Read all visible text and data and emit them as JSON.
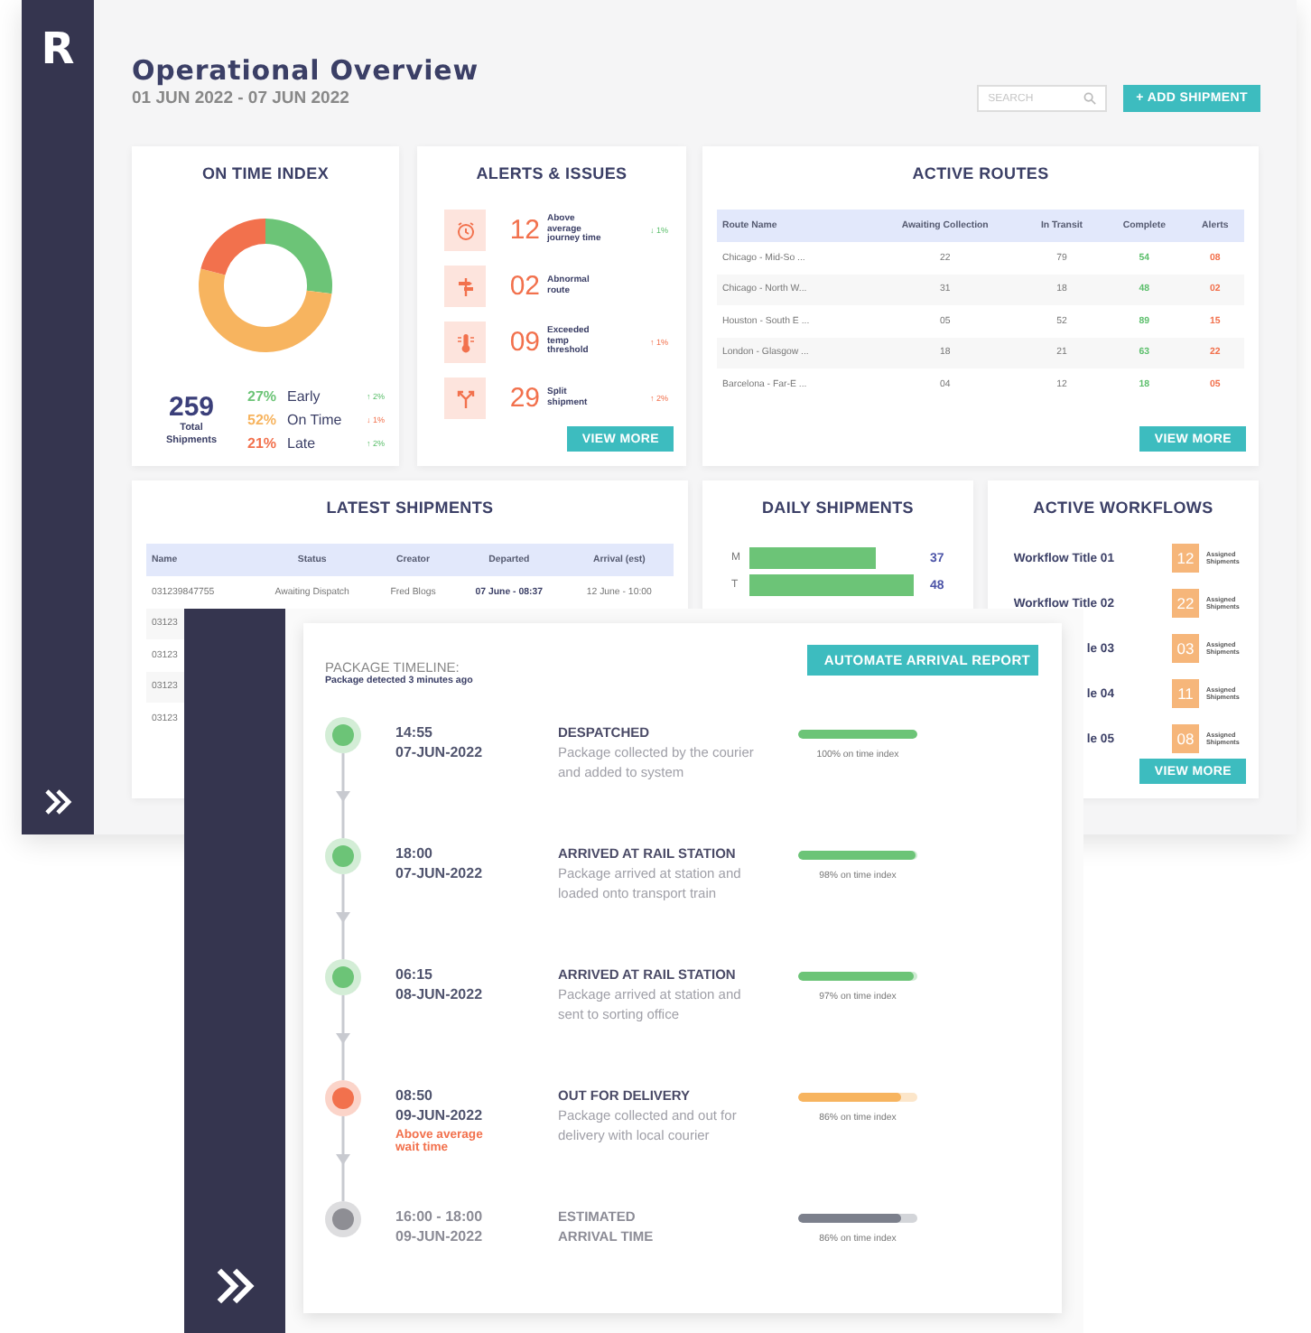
{
  "app": {
    "logo": "R"
  },
  "header": {
    "title": "Operational Overview",
    "date_range": "01 JUN 2022 - 07 JUN 2022",
    "search": {
      "placeholder": "SEARCH"
    },
    "add_button": "+ ADD SHIPMENT"
  },
  "on_time_index": {
    "title": "ON TIME INDEX",
    "chart_data": {
      "type": "donut",
      "categories": [
        "Early",
        "On Time",
        "Late"
      ],
      "values": [
        27,
        52,
        21
      ]
    },
    "total": "259",
    "total_label": "Total Shipments",
    "legend": [
      {
        "percent": "27%",
        "change": "↑ 2%",
        "good": true,
        "color": "#6cc477"
      },
      {
        "percent": "52%",
        "change": "↓ 1%",
        "good": false,
        "color": "#f7b45f"
      },
      {
        "percent": "21%",
        "change": "↑ 2%",
        "good": true,
        "color": "#f2714d"
      }
    ]
  },
  "alerts": {
    "title": "ALERTS & ISSUES",
    "button": "VIEW MORE",
    "items": [
      {
        "kind": "delay",
        "count": "12",
        "label": "Above average journey time",
        "change": "↓ 1%",
        "good": true
      },
      {
        "kind": "route",
        "count": "02",
        "label": "Abnormal route"
      },
      {
        "kind": "temperature",
        "count": "09",
        "label": "Exceeded temp threshold",
        "change": "↑ 1%",
        "good": false
      },
      {
        "kind": "split",
        "count": "29",
        "label": "Split shipment",
        "change": "↑ 2%",
        "good": false
      }
    ]
  },
  "active_routes": {
    "title": "ACTIVE ROUTES",
    "button": "VIEW MORE",
    "columns": [
      "Route Name",
      "Awaiting Collection",
      "In Transit",
      "Complete",
      "Alerts"
    ],
    "rows": [
      [
        "Chicago - Mid-So ...",
        "22",
        "79",
        "54",
        "08"
      ],
      [
        "Chicago - North W...",
        "31",
        "18",
        "48",
        "02"
      ],
      [
        "Houston - South E ...",
        "05",
        "52",
        "89",
        "15"
      ],
      [
        "London - Glasgow ...",
        "18",
        "21",
        "63",
        "22"
      ],
      [
        "Barcelona - Far-E ...",
        "04",
        "12",
        "18",
        "05"
      ]
    ]
  },
  "latest_shipments": {
    "title": "LATEST SHIPMENTS",
    "columns": [
      "Name",
      "Status",
      "Creator",
      "Departed",
      "Arrival (est)"
    ],
    "rows": [
      [
        "031239847755",
        "Awaiting Dispatch",
        "Fred Blogs",
        "07 June - 08:37",
        "12 June - 10:00"
      ],
      [
        "03123"
      ],
      [
        "03123"
      ],
      [
        "03123"
      ],
      [
        "03123"
      ]
    ]
  },
  "daily_shipments": {
    "title": "DAILY SHIPMENTS",
    "chart_data": {
      "type": "bar",
      "orientation": "horizontal",
      "categories": [
        "M",
        "T"
      ],
      "values": [
        37,
        48
      ],
      "data_labels": true
    }
  },
  "active_workflows": {
    "title": "ACTIVE WORKFLOWS",
    "button": "VIEW MORE",
    "items": [
      {
        "title": "Workflow Title 01",
        "count": "12",
        "label": "Assigned Shipments"
      },
      {
        "title": "Workflow Title 02",
        "count": "22",
        "label": "Assigned Shipments"
      },
      {
        "title": "le 03",
        "count": "03",
        "label": "Assigned Shipments"
      },
      {
        "title": "le 04",
        "count": "11",
        "label": "Assigned Shipments"
      },
      {
        "title": "le 05",
        "count": "08",
        "label": "Assigned Shipments"
      }
    ]
  },
  "package_timeline": {
    "title": "PACKAGE TIMELINE:",
    "subtitle": "Package detected 3 minutes ago",
    "button": "AUTOMATE ARRIVAL REPORT",
    "steps": [
      {
        "kind": "event",
        "color": "#6cc477",
        "time": "14:55",
        "date": "07-JUN-2022",
        "title": "DESPATCHED",
        "description": "Package collected by the courier and added to system",
        "progress": {
          "level": 1,
          "color": "#6cc477",
          "label": "100% on time index"
        }
      },
      {
        "kind": "event",
        "color": "#6cc477",
        "time": "18:00",
        "date": "07-JUN-2022",
        "title": "ARRIVED AT RAIL STATION",
        "description": "Package arrived at station and loaded onto transport train",
        "progress": {
          "level": 0.98,
          "color": "#6cc477",
          "label": "98% on time index"
        }
      },
      {
        "kind": "event",
        "color": "#6cc477",
        "time": "06:15",
        "date": "08-JUN-2022",
        "title": "ARRIVED AT RAIL STATION",
        "description": "Package arrived at station and sent to sorting office",
        "progress": {
          "level": 0.97,
          "color": "#6cc477",
          "label": "97% on time index"
        }
      },
      {
        "kind": "event",
        "color": "#f2714d",
        "time": "08:50",
        "date": "09-JUN-2022",
        "warning": "Above average wait time",
        "title": "OUT FOR DELIVERY",
        "description": "Package collected and out for delivery with local courier",
        "progress": {
          "level": 0.86,
          "color": "#f7b45f",
          "label": "86% on time index"
        }
      },
      {
        "kind": "estimate",
        "color": "#8e8e94",
        "time": "16:00 - 18:00",
        "date": "09-JUN-2022",
        "title": "ESTIMATED ARRIVAL TIME",
        "progress": {
          "level": 0.86,
          "color": "#7c808c",
          "label": "86% on time index"
        }
      }
    ]
  }
}
